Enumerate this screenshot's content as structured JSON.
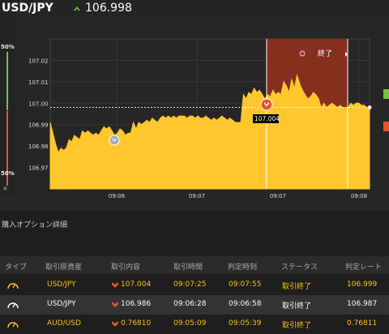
{
  "header": {
    "pair": "USD/JPY",
    "price": "106.998",
    "up_color": "#7bc043"
  },
  "gauge": {
    "top_pct": "50%",
    "bottom_pct": "50%",
    "close_label": "×",
    "up_color": "#7bc043",
    "down_color": "#e8562a"
  },
  "chart_data": {
    "type": "area",
    "x_labels": [
      "09:06",
      "09:07",
      "09:07",
      "09:08"
    ],
    "y_labels": [
      "107.02",
      "107.01",
      "107.00",
      "106.99",
      "106.98",
      "106.97"
    ],
    "ylim": [
      106.96,
      107.03
    ],
    "fill_color": "#ffc72c",
    "series": [
      106.991,
      106.986,
      106.981,
      106.977,
      106.979,
      106.978,
      106.979,
      106.983,
      106.982,
      106.985,
      106.984,
      106.983,
      106.987,
      106.986,
      106.987,
      106.986,
      106.985,
      106.986,
      106.985,
      106.987,
      106.989,
      106.988,
      106.989,
      106.987,
      106.985,
      106.986,
      106.988,
      106.987,
      106.985,
      106.986,
      106.986,
      106.991,
      106.988,
      106.991,
      106.99,
      106.991,
      106.992,
      106.991,
      106.993,
      106.992,
      106.991,
      106.993,
      106.994,
      106.993,
      106.994,
      106.993,
      106.994,
      106.993,
      106.994,
      106.994,
      106.994,
      106.993,
      106.994,
      106.994,
      106.993,
      106.994,
      106.993,
      106.993,
      106.994,
      106.993,
      106.992,
      106.993,
      106.992,
      106.993,
      106.994,
      106.993,
      106.992,
      106.993,
      106.992,
      106.991,
      106.991,
      106.991,
      107.004,
      107.002,
      107.005,
      107.004,
      107.007,
      107.005,
      107.006,
      107.004,
      107.002,
      107.004,
      107.003,
      107.006,
      107.004,
      107.005,
      107.004,
      107.01,
      107.008,
      107.005,
      107.011,
      107.007,
      107.013,
      107.009,
      107.006,
      107.004,
      107.002,
      107.003,
      107.005,
      107.004,
      107.002,
      106.998,
      107.0,
      106.998,
      106.999,
      107.0,
      106.999,
      106.998,
      106.999,
      106.998,
      106.998,
      106.998,
      107.0,
      106.999,
      107.0,
      107.0,
      106.999,
      106.999,
      106.998,
      106.998
    ],
    "reference_rate": "107.004",
    "period_label": "終了",
    "current_price": 106.998
  },
  "section_title": "購入オプション詳細",
  "table": {
    "columns": [
      "タイプ",
      "取引原資産",
      "取引内容",
      "取引時間",
      "判定時刻",
      "ステータス",
      "判定レート"
    ],
    "rows": [
      {
        "pair": "USD/JPY",
        "direction": "down",
        "rate": "107.004",
        "entry_time": "09:07:25",
        "judge_time": "09:07:55",
        "status": "取引終了",
        "judge_rate": "106.999"
      },
      {
        "pair": "USD/JPY",
        "direction": "down",
        "rate": "106.986",
        "entry_time": "09:06:28",
        "judge_time": "09:06:58",
        "status": "取引終了",
        "judge_rate": "106.987"
      },
      {
        "pair": "AUD/USD",
        "direction": "down",
        "rate": "0.76810",
        "entry_time": "09:05:09",
        "judge_time": "09:05:39",
        "status": "取引終了",
        "judge_rate": "0.76811"
      }
    ]
  }
}
